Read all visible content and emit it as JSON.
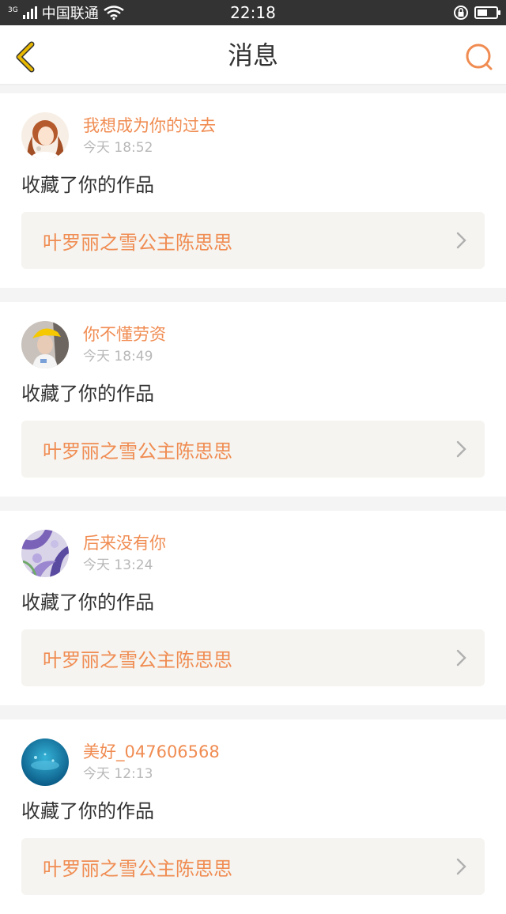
{
  "status_bar": {
    "network": "3G",
    "carrier": "中国联通",
    "time": "22:18"
  },
  "header": {
    "title": "消息"
  },
  "colors": {
    "accent": "#f08c52",
    "back_icon": "#e8b800",
    "status_bar_bg": "#333333"
  },
  "messages": [
    {
      "user": "我想成为你的过去",
      "time": "今天 18:52",
      "action": "收藏了你的作品",
      "work_title": "叶罗丽之雪公主陈思思",
      "avatar": "avatar-illustration-girl"
    },
    {
      "user": "你不懂劳资",
      "time": "今天 18:49",
      "action": "收藏了你的作品",
      "work_title": "叶罗丽之雪公主陈思思",
      "avatar": "avatar-yellow-cap"
    },
    {
      "user": "后来没有你",
      "time": "今天 13:24",
      "action": "收藏了你的作品",
      "work_title": "叶罗丽之雪公主陈思思",
      "avatar": "avatar-purple-flowers"
    },
    {
      "user": "美好_047606568",
      "time": "今天 12:13",
      "action": "收藏了你的作品",
      "work_title": "叶罗丽之雪公主陈思思",
      "avatar": "avatar-blue-water"
    }
  ]
}
